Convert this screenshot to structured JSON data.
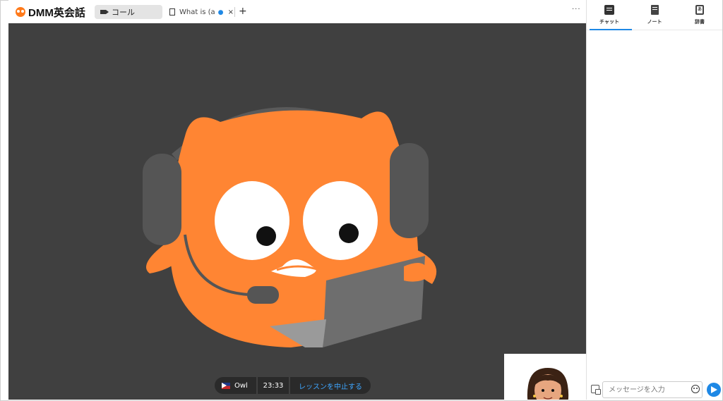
{
  "app": {
    "logo_text": "DMM英会話"
  },
  "tabs": [
    {
      "label": "コール",
      "icon": "video-camera-icon",
      "active": true
    },
    {
      "label": "What is (a",
      "icon": "document-icon",
      "active": false
    }
  ],
  "tab_close": "×",
  "tab_add": "+",
  "more_menu": "···",
  "call": {
    "tutor_name": "Owl",
    "timer": "23:33",
    "end_lesson_label": "レッスンを中止する",
    "flag": "philippines-flag-icon"
  },
  "sidebar": {
    "tabs": [
      {
        "label": "チャット",
        "icon": "chat-icon",
        "active": true
      },
      {
        "label": "ノート",
        "icon": "note-icon",
        "active": false
      },
      {
        "label": "辞書",
        "icon": "dictionary-icon",
        "active": false
      }
    ],
    "message_placeholder": "メッセージを入力"
  },
  "colors": {
    "accent": "#1e88e5",
    "brand_orange": "#ff7a1a",
    "video_bg": "#404040"
  }
}
